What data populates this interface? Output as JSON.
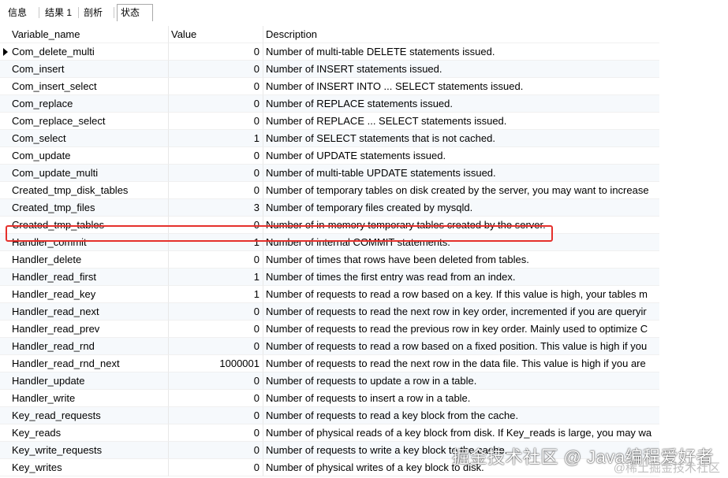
{
  "tabs": [
    "信息",
    "结果 1",
    "剖析",
    "状态"
  ],
  "active_tab_index": 3,
  "table": {
    "columns": [
      "Variable_name",
      "Value",
      "Description"
    ],
    "selected_row_index": 0,
    "highlighted_row_index": 9,
    "rows": [
      {
        "name": "Com_delete_multi",
        "value": "0",
        "desc": "Number of multi-table DELETE statements issued."
      },
      {
        "name": "Com_insert",
        "value": "0",
        "desc": "Number of INSERT statements issued."
      },
      {
        "name": "Com_insert_select",
        "value": "0",
        "desc": "Number of INSERT INTO ... SELECT statements issued."
      },
      {
        "name": "Com_replace",
        "value": "0",
        "desc": "Number of REPLACE statements issued."
      },
      {
        "name": "Com_replace_select",
        "value": "0",
        "desc": "Number of REPLACE ... SELECT statements issued."
      },
      {
        "name": "Com_select",
        "value": "1",
        "desc": "Number of SELECT statements that is not cached."
      },
      {
        "name": "Com_update",
        "value": "0",
        "desc": "Number of UPDATE statements issued."
      },
      {
        "name": "Com_update_multi",
        "value": "0",
        "desc": "Number of multi-table UPDATE statements issued."
      },
      {
        "name": "Created_tmp_disk_tables",
        "value": "0",
        "desc": "Number of temporary tables on disk created by the server, you may want to increase"
      },
      {
        "name": "Created_tmp_files",
        "value": "3",
        "desc": "Number of temporary files created by mysqld."
      },
      {
        "name": "Created_tmp_tables",
        "value": "0",
        "desc": "Number of in-memory temporary tables created by the server."
      },
      {
        "name": "Handler_commit",
        "value": "1",
        "desc": "Number of internal COMMIT statements."
      },
      {
        "name": "Handler_delete",
        "value": "0",
        "desc": "Number of times that rows have been deleted from tables."
      },
      {
        "name": "Handler_read_first",
        "value": "1",
        "desc": "Number of times the first entry was read from an index."
      },
      {
        "name": "Handler_read_key",
        "value": "1",
        "desc": "Number of requests to read a row based on a key. If this value is high, your tables m"
      },
      {
        "name": "Handler_read_next",
        "value": "0",
        "desc": "Number of requests to read the next row in key order, incremented if you are queryir"
      },
      {
        "name": "Handler_read_prev",
        "value": "0",
        "desc": "Number of requests to read the previous row in key order. Mainly used to optimize C"
      },
      {
        "name": "Handler_read_rnd",
        "value": "0",
        "desc": "Number of requests to read a row based on a fixed position. This value is high if you"
      },
      {
        "name": "Handler_read_rnd_next",
        "value": "1000001",
        "desc": "Number of requests to read the next row in the data file. This value is high if you are"
      },
      {
        "name": "Handler_update",
        "value": "0",
        "desc": "Number of requests to update a row in a table."
      },
      {
        "name": "Handler_write",
        "value": "0",
        "desc": "Number of requests to insert a row in a table."
      },
      {
        "name": "Key_read_requests",
        "value": "0",
        "desc": "Number of requests to read a key block from the cache."
      },
      {
        "name": "Key_reads",
        "value": "0",
        "desc": "Number of physical reads of a key block from disk. If Key_reads is large, you may wa"
      },
      {
        "name": "Key_write_requests",
        "value": "0",
        "desc": "Number of requests to write a key block to the cache."
      },
      {
        "name": "Key_writes",
        "value": "0",
        "desc": "Number of physical writes of a key block to disk."
      }
    ]
  },
  "watermark": {
    "main": "掘金技术社区 @ Java编程爱好者",
    "sub": "@稀土掘金技术社区"
  },
  "colors": {
    "highlight_border": "#e5302c",
    "alt_row": "#f6f9fc"
  }
}
